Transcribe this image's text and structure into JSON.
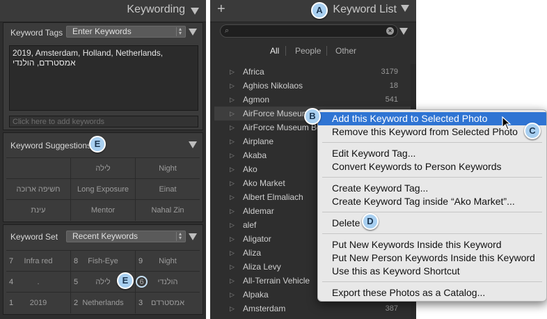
{
  "left": {
    "title": "Keywording",
    "tags": {
      "label": "Keyword Tags",
      "mode": "Enter Keywords",
      "text_line1": "2019, Amsterdam, Holland, Netherlands,",
      "text_line2": "אמסטרדם, הולנדי",
      "add_placeholder": "Click here to add keywords"
    },
    "suggestions": {
      "label": "Keyword Suggestions",
      "badge": "E",
      "cells": [
        "",
        "לילה",
        "Night",
        "חשיפה ארוכה",
        "Long Exposure",
        "Einat",
        "עינת",
        "Mentor",
        "Nahal Zin"
      ]
    },
    "set": {
      "label": "Keyword Set",
      "mode": "Recent Keywords",
      "badge": "E",
      "cells": [
        {
          "num": "7",
          "label": "Infra red"
        },
        {
          "num": "8",
          "label": "Fish-Eye"
        },
        {
          "num": "9",
          "label": "Night"
        },
        {
          "num": "4",
          "label": "."
        },
        {
          "num": "5",
          "label": "לילה"
        },
        {
          "num": "6",
          "label": "הולנדי"
        },
        {
          "num": "1",
          "label": "2019"
        },
        {
          "num": "2",
          "label": "Netherlands"
        },
        {
          "num": "3",
          "label": "אמסטרדם"
        }
      ],
      "highlight_num": "6"
    }
  },
  "right": {
    "add": "+",
    "title": "Keyword List",
    "badge_a": "A",
    "badge_b": "B",
    "badge_c": "C",
    "badge_d": "D",
    "filters": [
      "All",
      "People",
      "Other"
    ],
    "keywords": [
      {
        "name": "Africa",
        "count": "3179"
      },
      {
        "name": "Aghios Nikolaos",
        "count": "18"
      },
      {
        "name": "Agmon",
        "count": "541"
      },
      {
        "name": "AirForce Museum",
        "count": ""
      },
      {
        "name": "AirForce Museum Bee",
        "count": ""
      },
      {
        "name": "Airplane",
        "count": ""
      },
      {
        "name": "Akaba",
        "count": ""
      },
      {
        "name": "Ako",
        "count": ""
      },
      {
        "name": "Ako Market",
        "count": ""
      },
      {
        "name": "Albert Elmaliach",
        "count": ""
      },
      {
        "name": "Aldemar",
        "count": ""
      },
      {
        "name": "alef",
        "count": ""
      },
      {
        "name": "Aligator",
        "count": ""
      },
      {
        "name": "Aliza",
        "count": ""
      },
      {
        "name": "Aliza Levy",
        "count": ""
      },
      {
        "name": "All-Terrain Vehicle",
        "count": ""
      },
      {
        "name": "Alpaka",
        "count": ""
      },
      {
        "name": "Amsterdam",
        "count": "387"
      }
    ]
  },
  "menu": {
    "items": [
      "Add this Keyword to Selected Photo",
      "Remove this Keyword from Selected Photo",
      "Edit Keyword Tag...",
      "Convert Keywords to Person Keywords",
      "Create Keyword Tag...",
      "Create Keyword Tag inside “Ako Market”...",
      "Delete",
      "Put New Keywords Inside this Keyword",
      "Put New Person Keywords Inside this Keyword",
      "Use this as Keyword Shortcut",
      "Export these Photos as a Catalog..."
    ]
  },
  "colors": {
    "highlight": "#2f74d3",
    "badge": "#a8cff0",
    "panel_bg": "#2e2e2e"
  }
}
